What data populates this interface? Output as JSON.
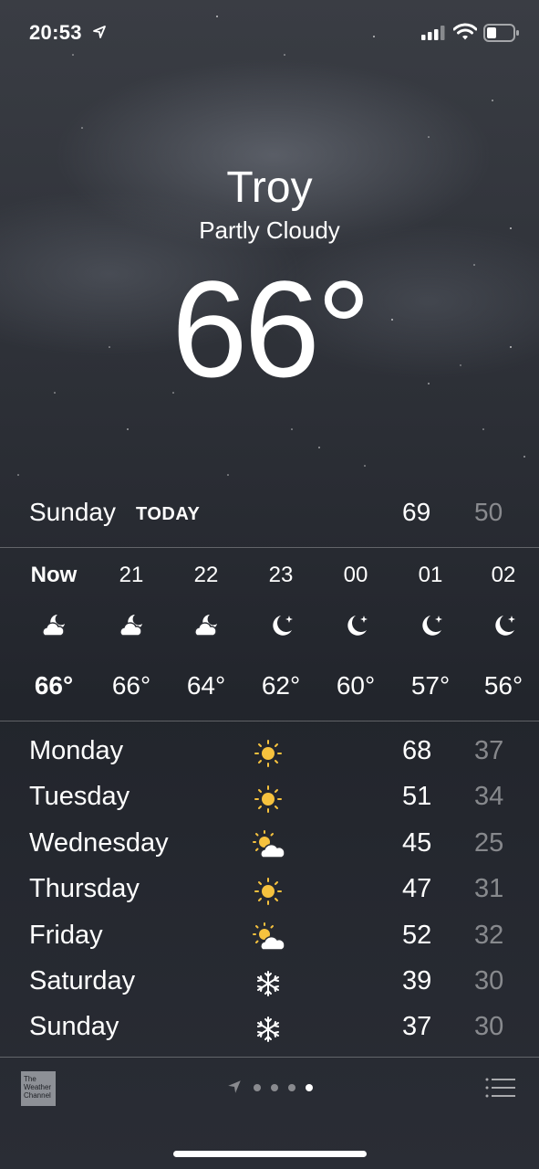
{
  "status_bar": {
    "time": "20:53"
  },
  "location": {
    "city": "Troy",
    "condition": "Partly Cloudy",
    "temperature": "66°"
  },
  "today": {
    "day": "Sunday",
    "tag": "TODAY",
    "high": "69",
    "low": "50"
  },
  "hourly": [
    {
      "label": "Now",
      "icon": "partly-cloudy-night-icon",
      "temp": "66°"
    },
    {
      "label": "21",
      "icon": "partly-cloudy-night-icon",
      "temp": "66°"
    },
    {
      "label": "22",
      "icon": "partly-cloudy-night-icon",
      "temp": "64°"
    },
    {
      "label": "23",
      "icon": "moon-stars-icon",
      "temp": "62°"
    },
    {
      "label": "00",
      "icon": "moon-stars-icon",
      "temp": "60°"
    },
    {
      "label": "01",
      "icon": "moon-stars-icon",
      "temp": "57°"
    },
    {
      "label": "02",
      "icon": "moon-stars-icon",
      "temp": "56°"
    }
  ],
  "daily": [
    {
      "day": "Monday",
      "icon": "sun-icon",
      "high": "68",
      "low": "37"
    },
    {
      "day": "Tuesday",
      "icon": "sun-icon",
      "high": "51",
      "low": "34"
    },
    {
      "day": "Wednesday",
      "icon": "partly-sunny-icon",
      "high": "45",
      "low": "25"
    },
    {
      "day": "Thursday",
      "icon": "sun-icon",
      "high": "47",
      "low": "31"
    },
    {
      "day": "Friday",
      "icon": "partly-sunny-icon",
      "high": "52",
      "low": "32"
    },
    {
      "day": "Saturday",
      "icon": "snowflake-icon",
      "high": "39",
      "low": "30"
    },
    {
      "day": "Sunday",
      "icon": "snowflake-icon",
      "high": "37",
      "low": "30"
    }
  ],
  "footer": {
    "brand_logo_text": "The Weather Channel",
    "page_count": 4,
    "active_page": 4
  },
  "colors": {
    "sun": "#f6c23e",
    "text": "#ffffff",
    "muted": "rgba(255,255,255,0.45)"
  }
}
